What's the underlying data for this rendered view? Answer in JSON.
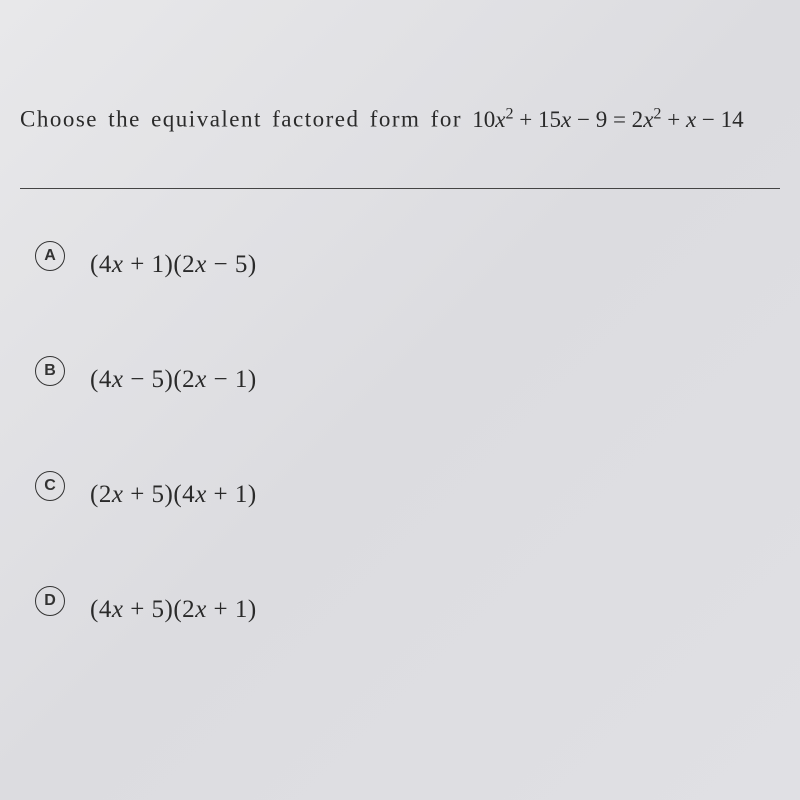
{
  "question": {
    "prompt": "Choose the equivalent factored form for",
    "equation_html": "<span class='num'>10</span>x<sup>2</sup> <span class='num'>+ 15</span>x <span class='num'>− 9 = 2</span>x<sup>2</sup> <span class='num'>+</span> x <span class='num'>− 14</span>"
  },
  "options": [
    {
      "letter": "A",
      "text_html": "<span class='num'>(4</span>x <span class='num'>+ 1)(2</span>x <span class='num'>− 5)</span>"
    },
    {
      "letter": "B",
      "text_html": "<span class='num'>(4</span>x <span class='num'>− 5)(2</span>x <span class='num'>− 1)</span>"
    },
    {
      "letter": "C",
      "text_html": "<span class='num'>(2</span>x <span class='num'>+ 5)(4</span>x <span class='num'>+ 1)</span>"
    },
    {
      "letter": "D",
      "text_html": "<span class='num'>(4</span>x <span class='num'>+ 5)(2</span>x <span class='num'>+ 1)</span>"
    }
  ]
}
